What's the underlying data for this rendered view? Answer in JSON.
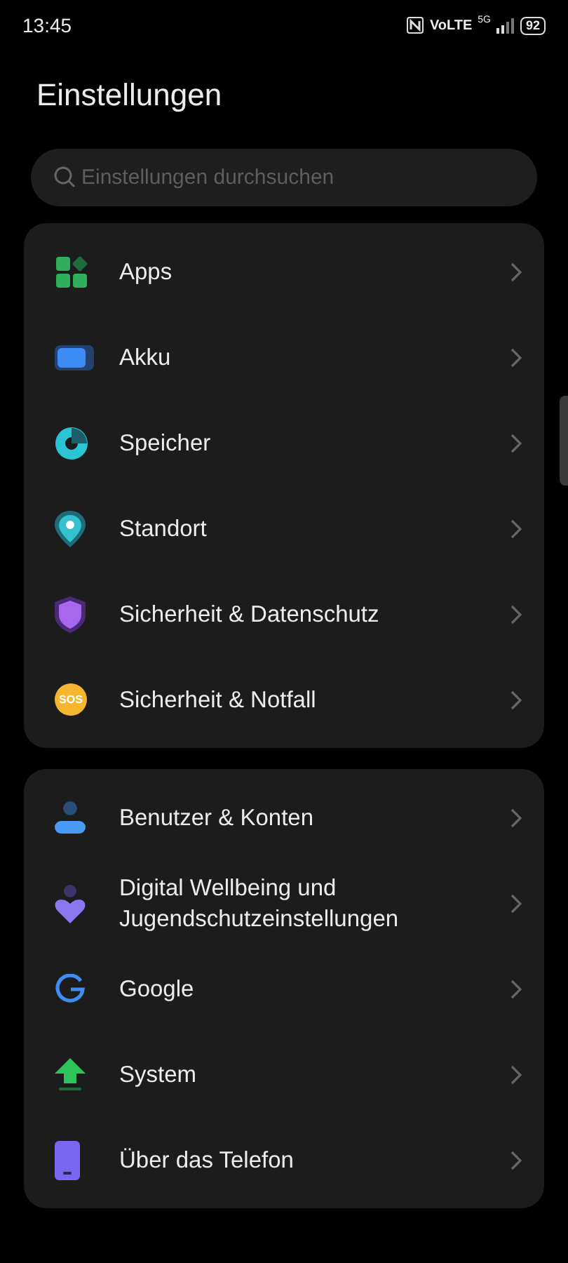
{
  "status_bar": {
    "time": "13:45",
    "network": "VoLTE",
    "generation": "5G",
    "battery": "92"
  },
  "title": "Einstellungen",
  "search": {
    "placeholder": "Einstellungen durchsuchen"
  },
  "groups": [
    {
      "items": [
        {
          "kind": "apps",
          "label": "Apps"
        },
        {
          "kind": "battery",
          "label": "Akku"
        },
        {
          "kind": "storage",
          "label": "Speicher"
        },
        {
          "kind": "location",
          "label": "Standort"
        },
        {
          "kind": "shield",
          "label": "Sicherheit & Datenschutz"
        },
        {
          "kind": "sos",
          "label": "Sicherheit & Notfall",
          "badge": "SOS"
        }
      ]
    },
    {
      "items": [
        {
          "kind": "user",
          "label": "Benutzer & Konten"
        },
        {
          "kind": "wellbeing",
          "label": "Digital Wellbeing und Jugendschutzeinstellungen"
        },
        {
          "kind": "google",
          "label": "Google"
        },
        {
          "kind": "system",
          "label": "System"
        },
        {
          "kind": "phone",
          "label": "Über das Telefon"
        }
      ]
    }
  ]
}
